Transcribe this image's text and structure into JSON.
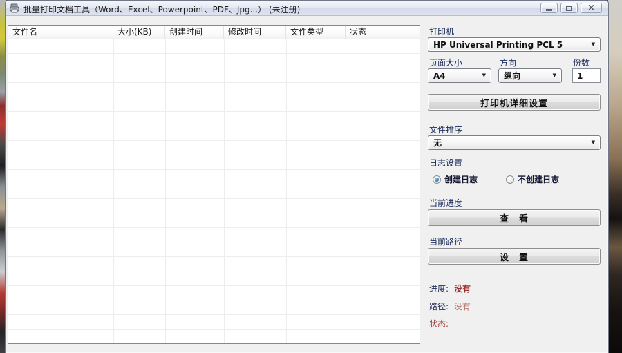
{
  "window": {
    "title": "批量打印文档工具（Word、Excel、Powerpoint、PDF、Jpg...） (未注册)",
    "controls": {
      "close_glyph": "×"
    }
  },
  "file_table": {
    "columns": [
      "文件名",
      "大小(KB)",
      "创建时间",
      "修改时间",
      "文件类型",
      "状态"
    ],
    "rows": []
  },
  "printer": {
    "label": "打印机",
    "value": "HP Universal Printing PCL 5",
    "page_size_label": "页面大小",
    "page_size_value": "A4",
    "orientation_label": "方向",
    "orientation_value": "纵向",
    "copies_label": "份数",
    "copies_value": "1",
    "settings_button": "打印机详细设置",
    "dropdown_arrow": "▼"
  },
  "sort": {
    "label": "文件排序",
    "value": "无"
  },
  "log": {
    "label": "日志设置",
    "options": [
      {
        "label": "创建日志",
        "selected": true
      },
      {
        "label": "不创建日志",
        "selected": false
      }
    ]
  },
  "progress": {
    "label": "当前进度",
    "view_button": "查　看"
  },
  "path": {
    "label": "当前路径",
    "set_button": "设　置"
  },
  "footer": {
    "progress_label": "进度:",
    "progress_value": "没有",
    "path_label": "路径:",
    "path_value": "没有",
    "status_label": "状态:",
    "status_value": ""
  },
  "colors": {
    "section_label": "#1c2d5e",
    "progress_value_red": "#9a2f2d",
    "path_value_red": "#b4726d",
    "status_maroon": "#9a4040",
    "radio_dot_blue": "#2f74b5",
    "client_bg": "#f0f0f0"
  }
}
